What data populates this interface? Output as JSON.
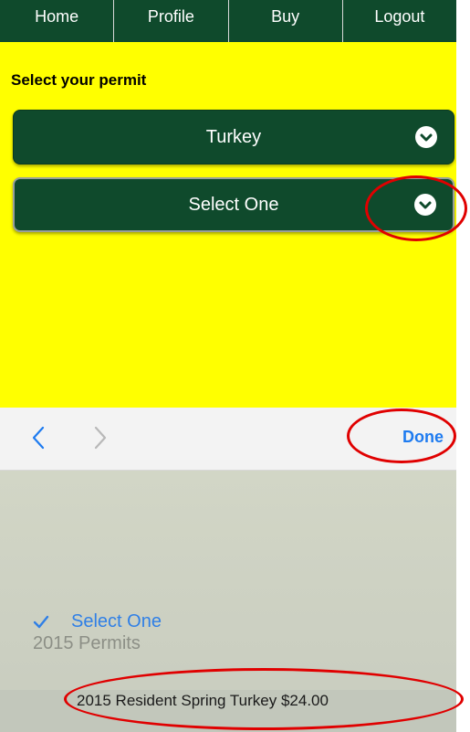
{
  "nav": {
    "items": [
      "Home",
      "Profile",
      "Buy",
      "Logout"
    ]
  },
  "page": {
    "heading": "Select your permit"
  },
  "selects": {
    "species": "Turkey",
    "permit": "Select One"
  },
  "toolbar": {
    "done_label": "Done",
    "prev_icon": "chevron-left-icon",
    "next_icon": "chevron-right-icon"
  },
  "picker": {
    "selected_option": "Select One",
    "group_label": "2015 Permits",
    "option": "2015 Resident Spring Turkey $24.00"
  },
  "colors": {
    "nav_bg": "#0f4a2c",
    "page_bg": "#ffff00",
    "accent": "#1e7bf0",
    "annotation": "#e00000"
  }
}
